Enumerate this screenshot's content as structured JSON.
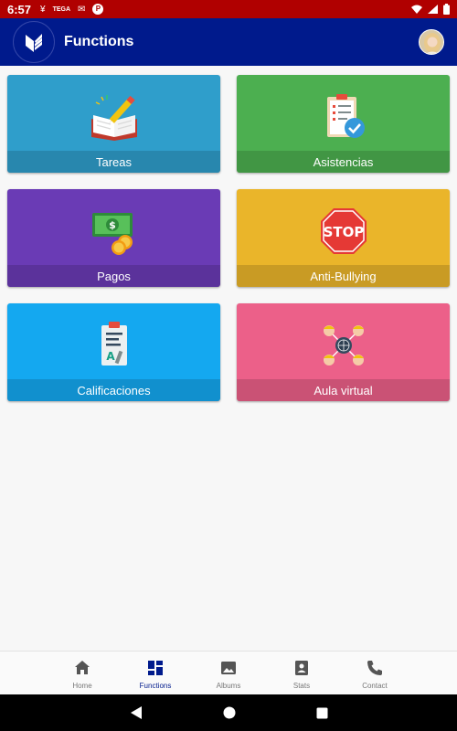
{
  "status_bar": {
    "time": "6:57",
    "notifications": [
      "¥",
      "TEGA",
      "✉",
      "P"
    ]
  },
  "app_bar": {
    "title": "Functions"
  },
  "cards": [
    {
      "label": "Tareas",
      "color": "#2f9ecb",
      "icon": "book-pencil-icon"
    },
    {
      "label": "Asistencias",
      "color": "#4caf50",
      "icon": "checklist-clipboard-icon"
    },
    {
      "label": "Pagos",
      "color": "#6a3bb5",
      "icon": "money-coins-icon"
    },
    {
      "label": "Anti-Bullying",
      "color": "#eab52a",
      "icon": "stop-sign-icon"
    },
    {
      "label": "Calificaciones",
      "color": "#14a8f0",
      "icon": "graded-paper-icon"
    },
    {
      "label": "Aula virtual",
      "color": "#ec6089",
      "icon": "network-people-icon"
    }
  ],
  "bottom_nav": [
    {
      "label": "Home",
      "icon": "home-icon"
    },
    {
      "label": "Functions",
      "icon": "dashboard-icon",
      "active": true
    },
    {
      "label": "Albums",
      "icon": "photo-icon"
    },
    {
      "label": "Stats",
      "icon": "stats-icon"
    },
    {
      "label": "Contact",
      "icon": "phone-icon"
    }
  ],
  "colors": {
    "status_bar": "#b00000",
    "app_bar": "#001a8c",
    "active_nav": "#001a8c"
  }
}
